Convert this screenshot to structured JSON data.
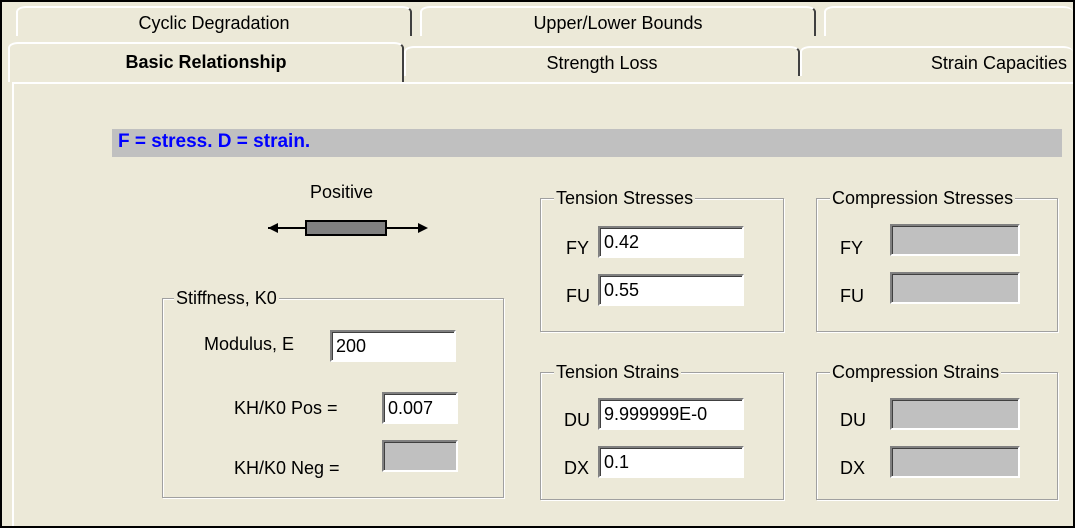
{
  "tabs": {
    "row_back": [
      "Cyclic Degradation",
      "Upper/Lower Bounds"
    ],
    "row_front": [
      "Basic Relationship",
      "Strength Loss",
      "Strain Capacities"
    ]
  },
  "banner": "F = stress.  D = strain.",
  "direction": {
    "label": "Positive"
  },
  "stiffness": {
    "title": "Stiffness, K0",
    "modulus_label": "Modulus, E",
    "modulus_value": "200",
    "kh_pos_label": "KH/K0 Pos =",
    "kh_pos_value": "0.007",
    "kh_neg_label": "KH/K0 Neg =",
    "kh_neg_value": ""
  },
  "tension_stresses": {
    "title": "Tension Stresses",
    "fy_label": "FY",
    "fy_value": "0.42",
    "fu_label": "FU",
    "fu_value": "0.55"
  },
  "compression_stresses": {
    "title": "Compression Stresses",
    "fy_label": "FY",
    "fy_value": "",
    "fu_label": "FU",
    "fu_value": ""
  },
  "tension_strains": {
    "title": "Tension Strains",
    "du_label": "DU",
    "du_value": "9.999999E-0",
    "dx_label": "DX",
    "dx_value": "0.1"
  },
  "compression_strains": {
    "title": "Compression Strains",
    "du_label": "DU",
    "du_value": "",
    "dx_label": "DX",
    "dx_value": ""
  }
}
